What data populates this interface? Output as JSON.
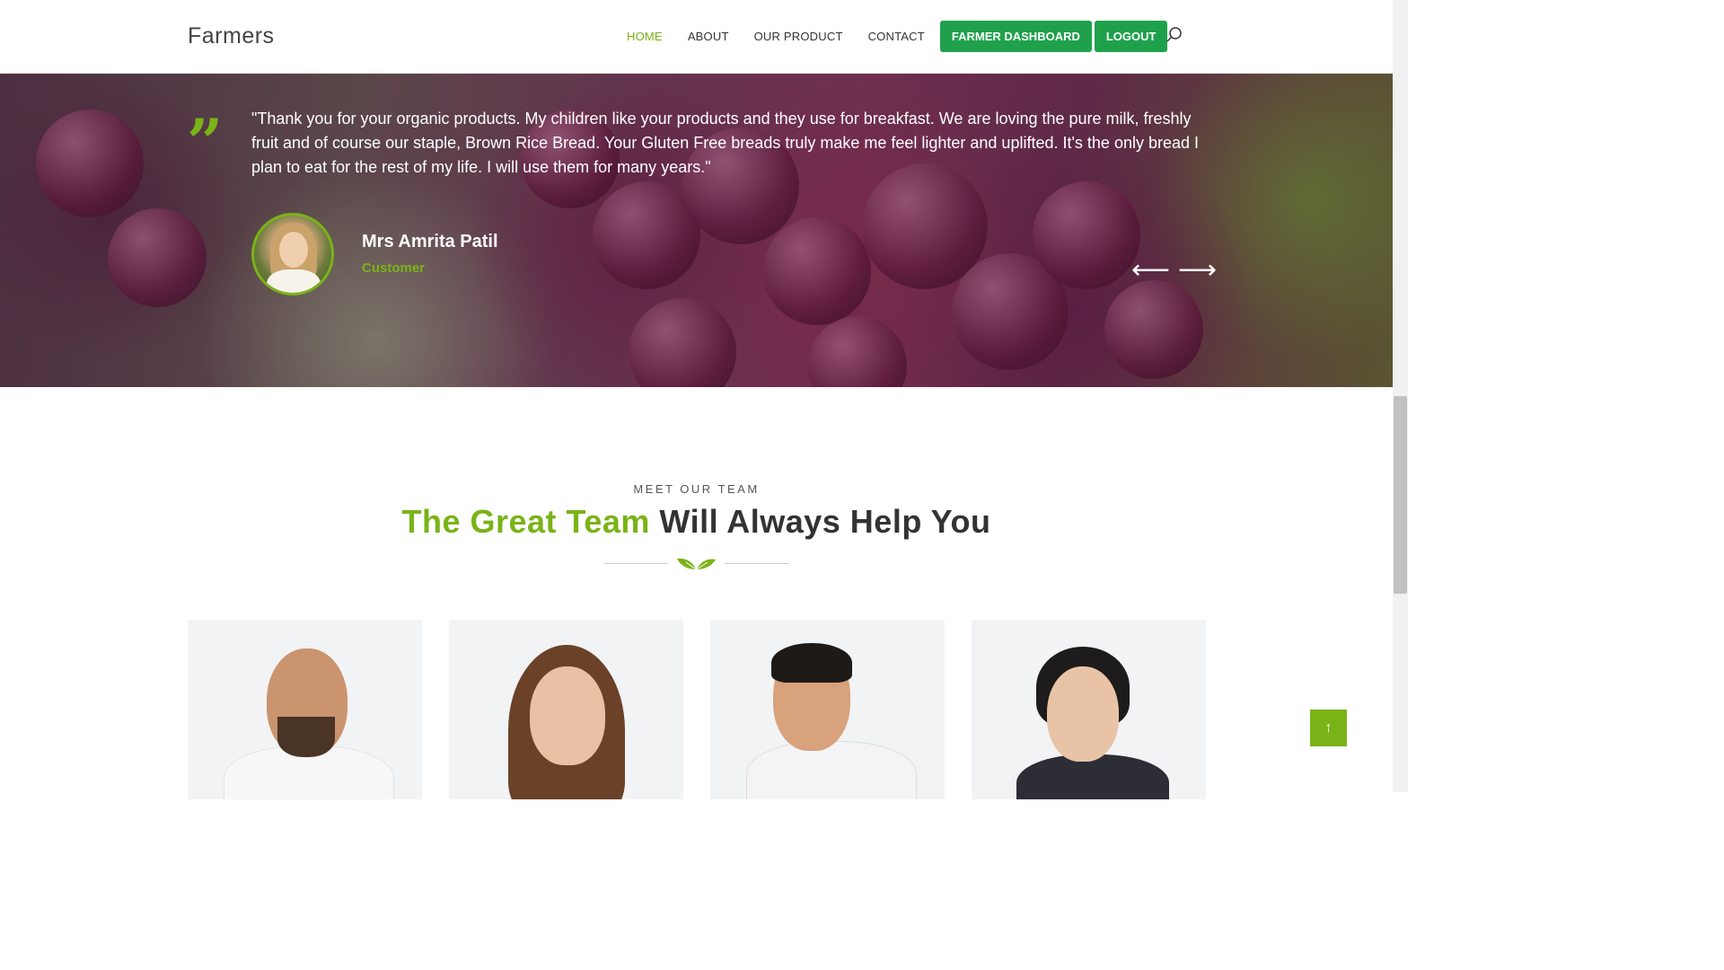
{
  "header": {
    "brand": "Farmers",
    "nav": [
      {
        "label": "HOME",
        "active": true
      },
      {
        "label": "ABOUT"
      },
      {
        "label": "OUR PRODUCT"
      },
      {
        "label": "CONTACT"
      }
    ],
    "buttons": {
      "dashboard": "FARMER DASHBOARD",
      "logout": "LOGOUT"
    }
  },
  "testimonial": {
    "quote_mark": "”",
    "text": "\"Thank you for your organic products. My children like your products and they use for breakfast. We are loving the pure milk, freshly fruit and of course our staple, Brown Rice Bread. Your Gluten Free breads truly make me feel lighter and uplifted. It's the only bread I plan to eat for the rest of my life. I will use them for many years.\"",
    "name": "Mrs Amrita Patil",
    "role": "Customer",
    "prev_arrow": "⟵",
    "next_arrow": "⟶"
  },
  "team": {
    "kicker": "MEET OUR TEAM",
    "title_highlight": "The Great Team",
    "title_rest": " Will Always Help You"
  },
  "back_to_top": "↑",
  "colors": {
    "accent_green": "#7ab317",
    "button_green": "#1fa14c",
    "card_bg": "#f2f3f5"
  }
}
